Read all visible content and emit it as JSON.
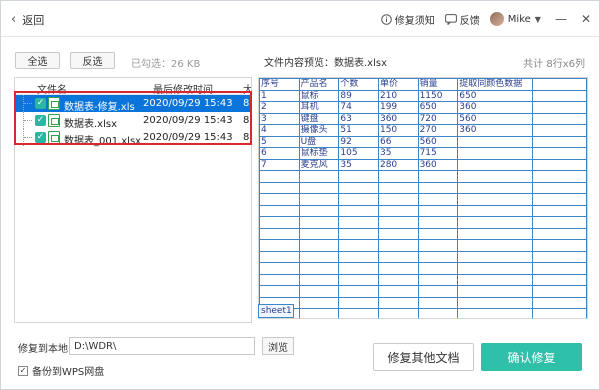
{
  "titlebar": {
    "back_label": "返回",
    "help_label": "修复须知",
    "feedback_label": "反馈",
    "user_name": "Mike",
    "icons": {
      "back": "chevron-left-icon",
      "help": "info-icon",
      "feedback": "chat-icon",
      "minimize": "minimize-icon",
      "close": "close-icon"
    }
  },
  "toolbar": {
    "select_all_label": "全选",
    "invert_label": "反选",
    "selected_info": "已勾选：26 KB",
    "preview_title": "文件内容预览：数据表.xlsx",
    "preview_count": "共计 8行x6列"
  },
  "file_list": {
    "columns": [
      "文件名",
      "最后修改时间",
      "大"
    ],
    "files": [
      {
        "name": "数据表-修复.xls",
        "date": "2020/09/29 15:43",
        "size": "8",
        "selected": true
      },
      {
        "name": "数据表.xlsx",
        "date": "2020/09/29 15:43",
        "size": "8",
        "selected": false
      },
      {
        "name": "数据表_001.xlsx",
        "date": "2020/09/29 15:43",
        "size": "8",
        "selected": false
      }
    ]
  },
  "preview": {
    "rows": [
      [
        "序号",
        "产品名",
        "个数",
        "单价",
        "销量",
        "提取同颜色数据",
        ""
      ],
      [
        "1",
        "鼠标",
        "89",
        "210",
        "1150",
        "650",
        ""
      ],
      [
        "2",
        "耳机",
        "74",
        "199",
        "650",
        "360",
        ""
      ],
      [
        "3",
        "键盘",
        "63",
        "360",
        "720",
        "560",
        ""
      ],
      [
        "4",
        "摄像头",
        "51",
        "150",
        "270",
        "360",
        ""
      ],
      [
        "5",
        "U盘",
        "92",
        "66",
        "560",
        "",
        ""
      ],
      [
        "6",
        "鼠标垫",
        "105",
        "35",
        "715",
        "",
        ""
      ],
      [
        "7",
        "麦克风",
        "35",
        "280",
        "360",
        "",
        ""
      ]
    ],
    "empty_rows": 14,
    "sheet_tab": "sheet1"
  },
  "bottom": {
    "restore_label": "修复到本地",
    "path_value": "D:\\WDR\\",
    "browse_label": "浏览",
    "backup_label": "备份到WPS网盘",
    "backup_checked": true,
    "other_button": "修复其他文档",
    "confirm_button": "确认修复"
  },
  "colors": {
    "accent": "#2bb5a2",
    "confirm_bg": "#2fc0aa",
    "selection": "#0a74da",
    "highlight_box": "#d9272e",
    "grid_line": "#3b86c8"
  }
}
